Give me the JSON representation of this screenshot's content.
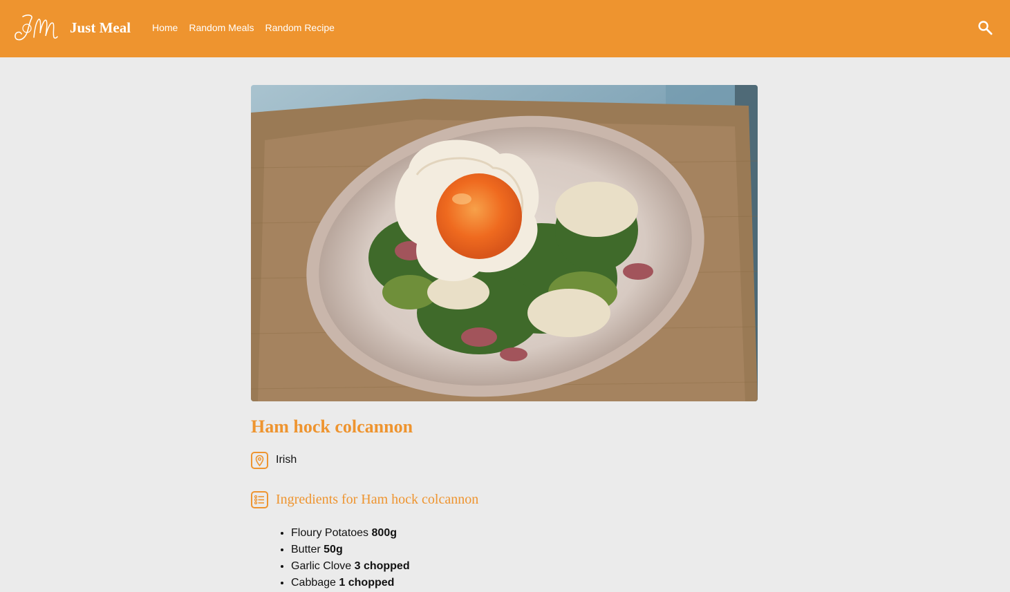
{
  "app": {
    "logo_text": "JM",
    "brand": "Just Meal"
  },
  "nav": {
    "items": [
      {
        "label": "Home"
      },
      {
        "label": "Random Meals"
      },
      {
        "label": "Random Recipe"
      }
    ]
  },
  "icons": {
    "search": "search-icon",
    "area": "map-pin-icon",
    "ingredients": "list-icon"
  },
  "colors": {
    "accent": "#ee942f",
    "background": "#ebebeb"
  },
  "meal": {
    "title": "Ham hock colcannon",
    "area": "Irish",
    "ingredients_heading": "Ingredients for Ham hock colcannon",
    "ingredients": [
      {
        "name": "Floury Potatoes",
        "measure": "800g"
      },
      {
        "name": "Butter",
        "measure": "50g"
      },
      {
        "name": "Garlic Clove",
        "measure": "3 chopped"
      },
      {
        "name": "Cabbage",
        "measure": "1 chopped"
      }
    ]
  }
}
